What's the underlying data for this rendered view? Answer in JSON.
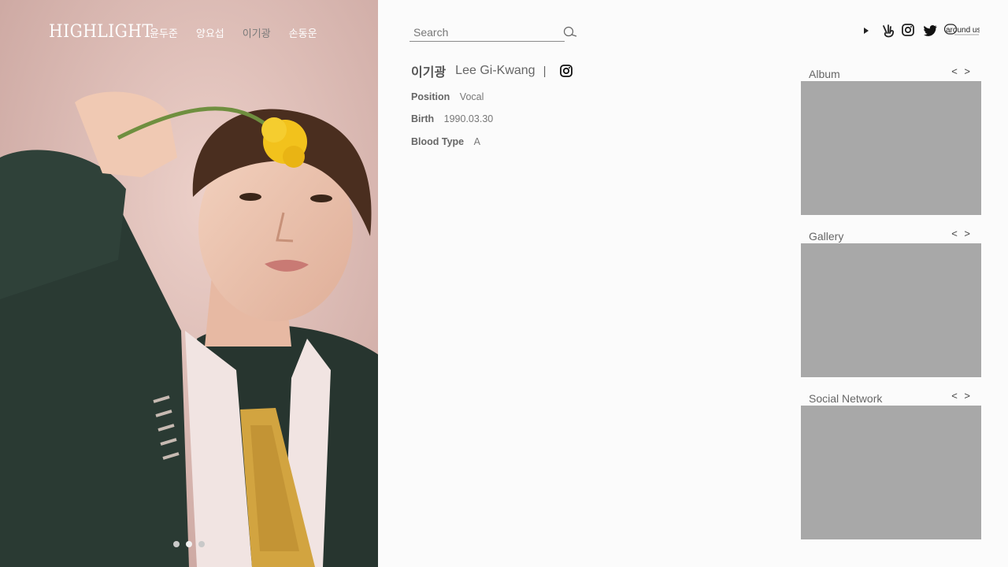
{
  "brand": {
    "logo_text": "HIGHLIGHT"
  },
  "nav": {
    "members": [
      {
        "label": "윤두준",
        "active": false
      },
      {
        "label": "양요섭",
        "active": false
      },
      {
        "label": "이기광",
        "active": true
      },
      {
        "label": "손동운",
        "active": false
      }
    ]
  },
  "hero": {
    "image": "member-portrait-yellow-flower",
    "slides_total": 3,
    "active_slide": 2
  },
  "search": {
    "placeholder": "Search",
    "value": "",
    "icon": "search-icon"
  },
  "social_links": [
    {
      "icon": "play-icon",
      "name": ""
    },
    {
      "icon": "vlive-icon",
      "name": ""
    },
    {
      "icon": "instagram-icon",
      "name": ""
    },
    {
      "icon": "twitter-icon",
      "name": ""
    },
    {
      "icon": "around-us-logo",
      "name": "around us"
    }
  ],
  "profile": {
    "name_ko": "이기광",
    "name_en": "Lee Gi-Kwang",
    "separator": "|",
    "insta_icon": "instagram-icon",
    "fields": [
      {
        "label": "Position",
        "value": "Vocal"
      },
      {
        "label": "Birth",
        "value": "1990.03.30"
      },
      {
        "label": "Blood Type",
        "value": "A"
      }
    ]
  },
  "sections": [
    {
      "title": "Album",
      "prev": "<",
      "next": ">"
    },
    {
      "title": "Gallery",
      "prev": "<",
      "next": ">"
    },
    {
      "title": "Social Network",
      "prev": "<",
      "next": ">"
    }
  ],
  "colors": {
    "page_bg": "#fbfbfb",
    "placeholder_box": "#a8a8a8",
    "nav_active": "#7a7a7a",
    "hero_bg": "#d9b4ad",
    "flower": "#f2c21c"
  }
}
